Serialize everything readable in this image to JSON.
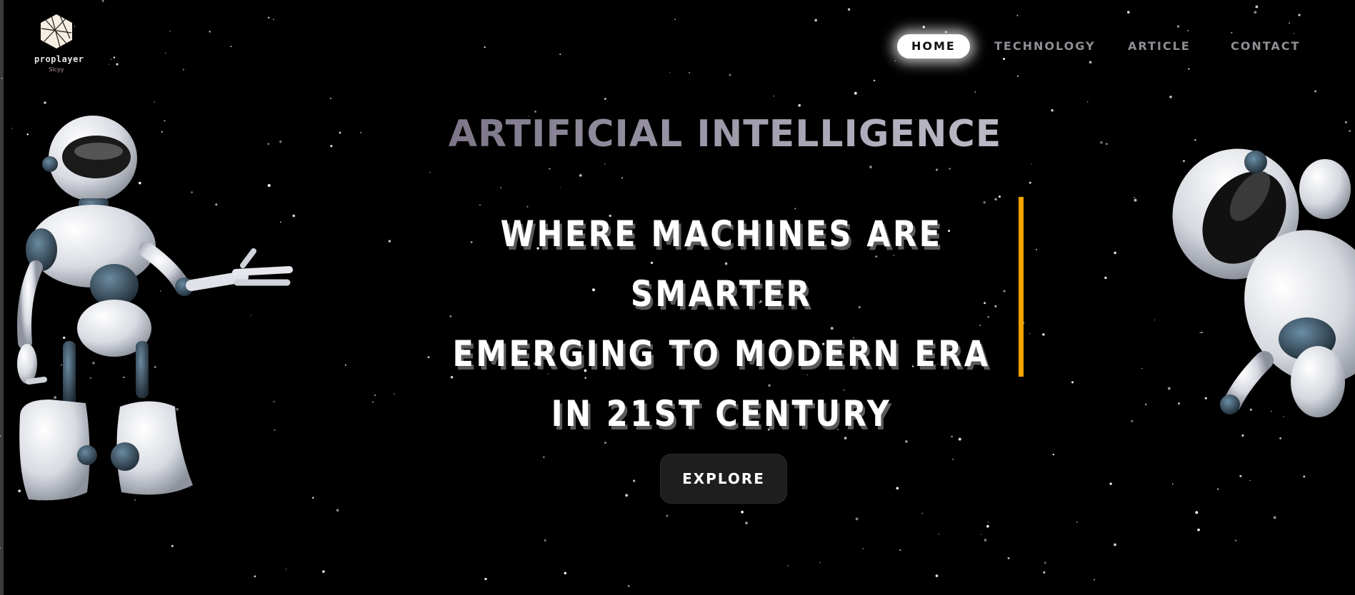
{
  "brand": {
    "name": "proplayer",
    "tagline": "Slcyy",
    "logo_icon": "hexagon-lines-icon"
  },
  "nav": {
    "items": [
      {
        "label": "HOME",
        "active": true
      },
      {
        "label": "TECHNOLOGY",
        "active": false
      },
      {
        "label": "ARTICLE",
        "active": false
      },
      {
        "label": "CONTACT",
        "active": false
      }
    ]
  },
  "hero": {
    "overline": "ARTIFICIAL INTELLIGENCE",
    "lines": [
      "WHERE MACHINES ARE SMARTER",
      "EMERGING TO MODERN ERA",
      "IN 21ST CENTURY"
    ],
    "cta_label": "EXPLORE"
  },
  "colors": {
    "background": "#000000",
    "caret": "#f5a300",
    "cta_background": "#1e1e1e",
    "nav_active_background": "#ffffff",
    "nav_text": "#8f8f96"
  }
}
